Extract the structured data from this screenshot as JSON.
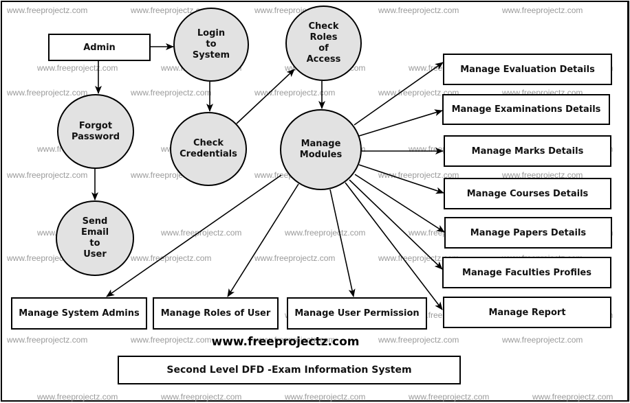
{
  "watermark_text": "www.freeprojectz.com",
  "site_label": "www.freeprojectz.com",
  "title": "Second Level DFD -Exam Information System",
  "colors": {
    "process_fill": "#e2e2e2",
    "stroke": "#000000",
    "watermark": "#9a9a9a"
  },
  "entities": {
    "admin": "Admin",
    "manage_evaluation": "Manage Evaluation Details",
    "manage_examinations": "Manage Examinations Details",
    "manage_marks": "Manage Marks Details",
    "manage_courses": "Manage Courses Details",
    "manage_papers": "Manage Papers Details",
    "manage_faculties": "Manage Faculties Profiles",
    "manage_report": "Manage  Report",
    "manage_system_admins": "Manage System Admins",
    "manage_roles_of_user": "Manage Roles of User",
    "manage_user_permission": "Manage User Permission"
  },
  "processes": {
    "login": "Login\nto\nSystem",
    "check_roles": "Check\nRoles\nof\nAccess",
    "forgot_password": "Forgot\nPassword",
    "check_credentials": "Check\nCredentials",
    "manage_modules": "Manage\nModules",
    "send_email": "Send\nEmail\nto\nUser"
  },
  "flows": [
    [
      "admin",
      "login"
    ],
    [
      "admin",
      "forgot_password"
    ],
    [
      "login",
      "check_credentials"
    ],
    [
      "check_credentials",
      "check_roles"
    ],
    [
      "check_roles",
      "manage_modules"
    ],
    [
      "forgot_password",
      "send_email"
    ],
    [
      "manage_modules",
      "manage_evaluation"
    ],
    [
      "manage_modules",
      "manage_examinations"
    ],
    [
      "manage_modules",
      "manage_marks"
    ],
    [
      "manage_modules",
      "manage_courses"
    ],
    [
      "manage_modules",
      "manage_papers"
    ],
    [
      "manage_modules",
      "manage_faculties"
    ],
    [
      "manage_modules",
      "manage_report"
    ],
    [
      "manage_modules",
      "manage_system_admins"
    ],
    [
      "manage_modules",
      "manage_roles_of_user"
    ],
    [
      "manage_modules",
      "manage_user_permission"
    ]
  ]
}
